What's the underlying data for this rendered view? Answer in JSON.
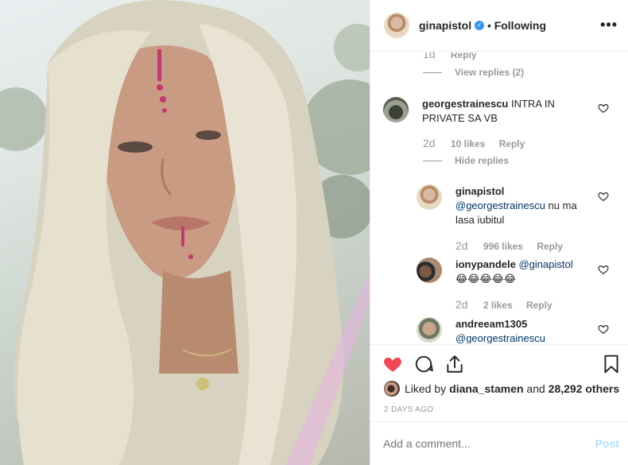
{
  "post": {
    "username": "ginapistol",
    "follow_state": "Following",
    "separator": "•"
  },
  "comments_top": {
    "prev_age": "1d",
    "prev_reply": "Reply",
    "view_replies": "View replies (2)"
  },
  "comments": [
    {
      "username": "georgestrainescu",
      "text": "INTRA IN PRIVATE SA VB",
      "age": "2d",
      "likes": "10 likes",
      "reply": "Reply",
      "toggle": "Hide replies"
    }
  ],
  "replies": [
    {
      "username": "ginapistol",
      "mention": "@georgestrainescu",
      "text": " nu ma lasa iubitul",
      "age": "2d",
      "likes": "996 likes",
      "reply": "Reply"
    },
    {
      "username": "ionypandele",
      "mention": "@ginapistol",
      "text": "😂😂😂😂😂",
      "age": "2d",
      "likes": "2 likes",
      "reply": "Reply"
    },
    {
      "username": "andreeam1305",
      "mention": "@georgestrainescu",
      "text": ""
    }
  ],
  "likes": {
    "prefix": "Liked by ",
    "user": "diana_stamen",
    "middle": " and ",
    "count": "28,292 others"
  },
  "timestamp": "2 DAYS AGO",
  "composer": {
    "placeholder": "Add a comment...",
    "post_label": "Post"
  },
  "colors": {
    "like_red": "#ed4956",
    "link_blue": "#003569",
    "verified_blue": "#3897f0",
    "post_disabled": "#b2dffc"
  }
}
